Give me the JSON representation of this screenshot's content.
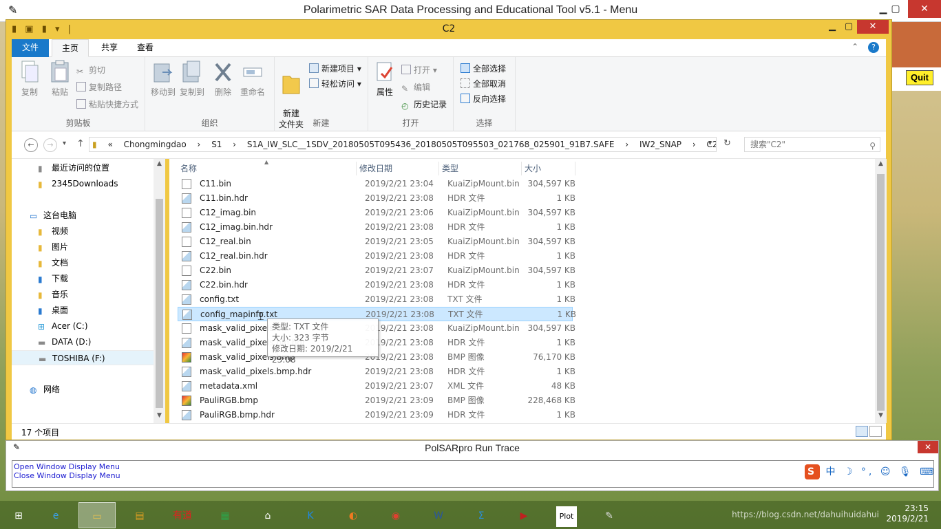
{
  "background_app": {
    "title": "Polarimetric SAR Data Processing and Educational Tool v5.1 - Menu",
    "quit_label": "Quit",
    "minimize": "▁",
    "maximize": "▢",
    "close": "✕"
  },
  "explorer": {
    "title": "C2",
    "tabs": [
      "文件",
      "主页",
      "共享",
      "查看"
    ],
    "ribbon": {
      "clipboard": {
        "label": "剪贴板",
        "copy": "复制",
        "paste": "粘贴",
        "cut": "剪切",
        "copy_path": "复制路径",
        "paste_shortcut": "粘贴快捷方式"
      },
      "organize": {
        "label": "组织",
        "move_to": "移动到",
        "copy_to": "复制到",
        "delete": "删除",
        "rename": "重命名"
      },
      "new": {
        "label": "新建",
        "new_folder": "新建\n文件夹",
        "new_item": "新建项目 ▾",
        "easy_access": "轻松访问 ▾"
      },
      "open": {
        "label": "打开",
        "properties": "属性",
        "open": "打开 ▾",
        "edit": "编辑",
        "history": "历史记录"
      },
      "select": {
        "label": "选择",
        "select_all": "全部选择",
        "select_none": "全部取消",
        "invert": "反向选择"
      }
    },
    "address": {
      "crumbs": [
        "«",
        "Chongmingdao",
        "›",
        "S1",
        "›",
        "S1A_IW_SLC__1SDV_20180505T095436_20180505T095503_021768_025901_91B7.SAFE",
        "›",
        "IW2_SNAP",
        "›",
        "C2"
      ],
      "search_placeholder": "搜索\"C2\""
    },
    "nav": [
      {
        "label": "最近访问的位置",
        "icon": "recent-icon",
        "indent": 1
      },
      {
        "label": "2345Downloads",
        "icon": "folder-icon",
        "indent": 1
      },
      {
        "label": "这台电脑",
        "icon": "computer-icon",
        "indent": 0
      },
      {
        "label": "视频",
        "icon": "video-folder-icon",
        "indent": 1
      },
      {
        "label": "图片",
        "icon": "pictures-folder-icon",
        "indent": 1
      },
      {
        "label": "文档",
        "icon": "documents-folder-icon",
        "indent": 1
      },
      {
        "label": "下载",
        "icon": "downloads-folder-icon",
        "indent": 1
      },
      {
        "label": "音乐",
        "icon": "music-folder-icon",
        "indent": 1
      },
      {
        "label": "桌面",
        "icon": "desktop-folder-icon",
        "indent": 1
      },
      {
        "label": "Acer (C:)",
        "icon": "windows-drive-icon",
        "indent": 1
      },
      {
        "label": "DATA (D:)",
        "icon": "drive-icon",
        "indent": 1
      },
      {
        "label": "TOSHIBA (F:)",
        "icon": "drive-icon",
        "indent": 1
      },
      {
        "label": "网络",
        "icon": "network-icon",
        "indent": 0
      }
    ],
    "columns": [
      "名称",
      "修改日期",
      "类型",
      "大小"
    ],
    "files": [
      {
        "name": "C11.bin",
        "date": "2019/2/21 23:04",
        "type": "KuaiZipMount.bin",
        "size": "304,597 KB",
        "icon": "blank"
      },
      {
        "name": "C11.bin.hdr",
        "date": "2019/2/21 23:08",
        "type": "HDR 文件",
        "size": "1 KB",
        "icon": "hdr"
      },
      {
        "name": "C12_imag.bin",
        "date": "2019/2/21 23:06",
        "type": "KuaiZipMount.bin",
        "size": "304,597 KB",
        "icon": "blank"
      },
      {
        "name": "C12_imag.bin.hdr",
        "date": "2019/2/21 23:08",
        "type": "HDR 文件",
        "size": "1 KB",
        "icon": "hdr"
      },
      {
        "name": "C12_real.bin",
        "date": "2019/2/21 23:05",
        "type": "KuaiZipMount.bin",
        "size": "304,597 KB",
        "icon": "blank"
      },
      {
        "name": "C12_real.bin.hdr",
        "date": "2019/2/21 23:08",
        "type": "HDR 文件",
        "size": "1 KB",
        "icon": "hdr"
      },
      {
        "name": "C22.bin",
        "date": "2019/2/21 23:07",
        "type": "KuaiZipMount.bin",
        "size": "304,597 KB",
        "icon": "blank"
      },
      {
        "name": "C22.bin.hdr",
        "date": "2019/2/21 23:08",
        "type": "HDR 文件",
        "size": "1 KB",
        "icon": "hdr"
      },
      {
        "name": "config.txt",
        "date": "2019/2/21 23:08",
        "type": "TXT 文件",
        "size": "1 KB",
        "icon": "hdr"
      },
      {
        "name": "config_mapinfo.txt",
        "date": "2019/2/21 23:08",
        "type": "TXT 文件",
        "size": "1 KB",
        "icon": "hdr",
        "selected": true
      },
      {
        "name": "mask_valid_pixels.bin",
        "date": "2019/2/21 23:08",
        "type": "KuaiZipMount.bin",
        "size": "304,597 KB",
        "icon": "blank"
      },
      {
        "name": "mask_valid_pixels.bin.hdr",
        "date": "2019/2/21 23:08",
        "type": "HDR 文件",
        "size": "1 KB",
        "icon": "hdr"
      },
      {
        "name": "mask_valid_pixels.bmp",
        "date": "2019/2/21 23:08",
        "type": "BMP 图像",
        "size": "76,170 KB",
        "icon": "img"
      },
      {
        "name": "mask_valid_pixels.bmp.hdr",
        "date": "2019/2/21 23:08",
        "type": "HDR 文件",
        "size": "1 KB",
        "icon": "hdr"
      },
      {
        "name": "metadata.xml",
        "date": "2019/2/21 23:07",
        "type": "XML 文件",
        "size": "48 KB",
        "icon": "hdr"
      },
      {
        "name": "PauliRGB.bmp",
        "date": "2019/2/21 23:09",
        "type": "BMP 图像",
        "size": "228,468 KB",
        "icon": "img"
      },
      {
        "name": "PauliRGB.bmp.hdr",
        "date": "2019/2/21 23:09",
        "type": "HDR 文件",
        "size": "1 KB",
        "icon": "hdr"
      }
    ],
    "tooltip": [
      "类型: TXT 文件",
      "大小: 323 字节",
      "修改日期: 2019/2/21 23:08"
    ],
    "status": "17 个项目"
  },
  "trace": {
    "title": "PolSARpro Run Trace",
    "log": [
      "Open Window Display Menu",
      "Close Window Display Menu"
    ],
    "close": "✕",
    "ime": "中"
  },
  "taskbar": {
    "apps": [
      {
        "name": "start",
        "glyph": "⊞",
        "color": "#ffffff"
      },
      {
        "name": "ie",
        "glyph": "e",
        "color": "#3aa0e8"
      },
      {
        "name": "explorer",
        "glyph": "▭",
        "color": "#e8c050",
        "active": true
      },
      {
        "name": "archive",
        "glyph": "▤",
        "color": "#e0a020"
      },
      {
        "name": "youdao",
        "glyph": "有道",
        "color": "#e02020"
      },
      {
        "name": "store",
        "glyph": "▦",
        "color": "#2da44a"
      },
      {
        "name": "home",
        "glyph": "⌂",
        "color": "#ffffff"
      },
      {
        "name": "kuaizip",
        "glyph": "K",
        "color": "#1e88e5"
      },
      {
        "name": "browser",
        "glyph": "◐",
        "color": "#f07a20"
      },
      {
        "name": "chrome",
        "glyph": "◉",
        "color": "#e04030"
      },
      {
        "name": "word",
        "glyph": "W",
        "color": "#2b579a"
      },
      {
        "name": "sigma",
        "glyph": "Σ",
        "color": "#2a8fd8"
      },
      {
        "name": "player",
        "glyph": "▶",
        "color": "#c02020"
      },
      {
        "name": "plot",
        "glyph": "Plot",
        "color": "#ffffff"
      },
      {
        "name": "feather",
        "glyph": "✎",
        "color": "#d8d8d8"
      }
    ],
    "url": "https://blog.csdn.net/dahuihuidahui",
    "time": "23:15",
    "date": "2019/2/21"
  }
}
